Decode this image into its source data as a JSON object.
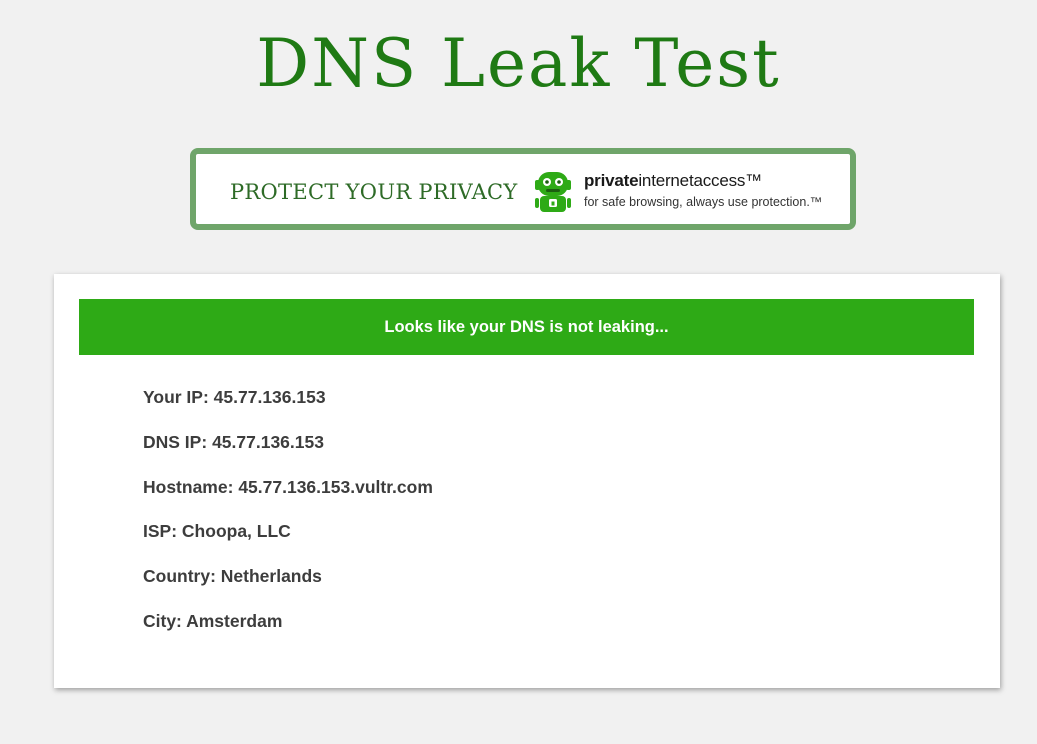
{
  "page": {
    "title": "DNS Leak Test"
  },
  "banner": {
    "text": "PROTECT YOUR PRIVACY",
    "brand_bold": "private",
    "brand_regular": "internetaccess",
    "brand_tm": "™",
    "tagline": "for safe browsing, always use protection.™",
    "logo_icon": "pia-robot-icon",
    "border_color": "#6fa56a",
    "logo_color": "#2eaa16"
  },
  "result": {
    "status_message": "Looks like your DNS is not leaking...",
    "status_color": "#2eaa16",
    "details": [
      {
        "label": "Your IP:",
        "value": "45.77.136.153"
      },
      {
        "label": "DNS IP:",
        "value": "45.77.136.153"
      },
      {
        "label": "Hostname:",
        "value": "45.77.136.153.vultr.com"
      },
      {
        "label": "ISP:",
        "value": "Choopa, LLC"
      },
      {
        "label": "Country:",
        "value": "Netherlands"
      },
      {
        "label": "City:",
        "value": "Amsterdam"
      }
    ]
  }
}
